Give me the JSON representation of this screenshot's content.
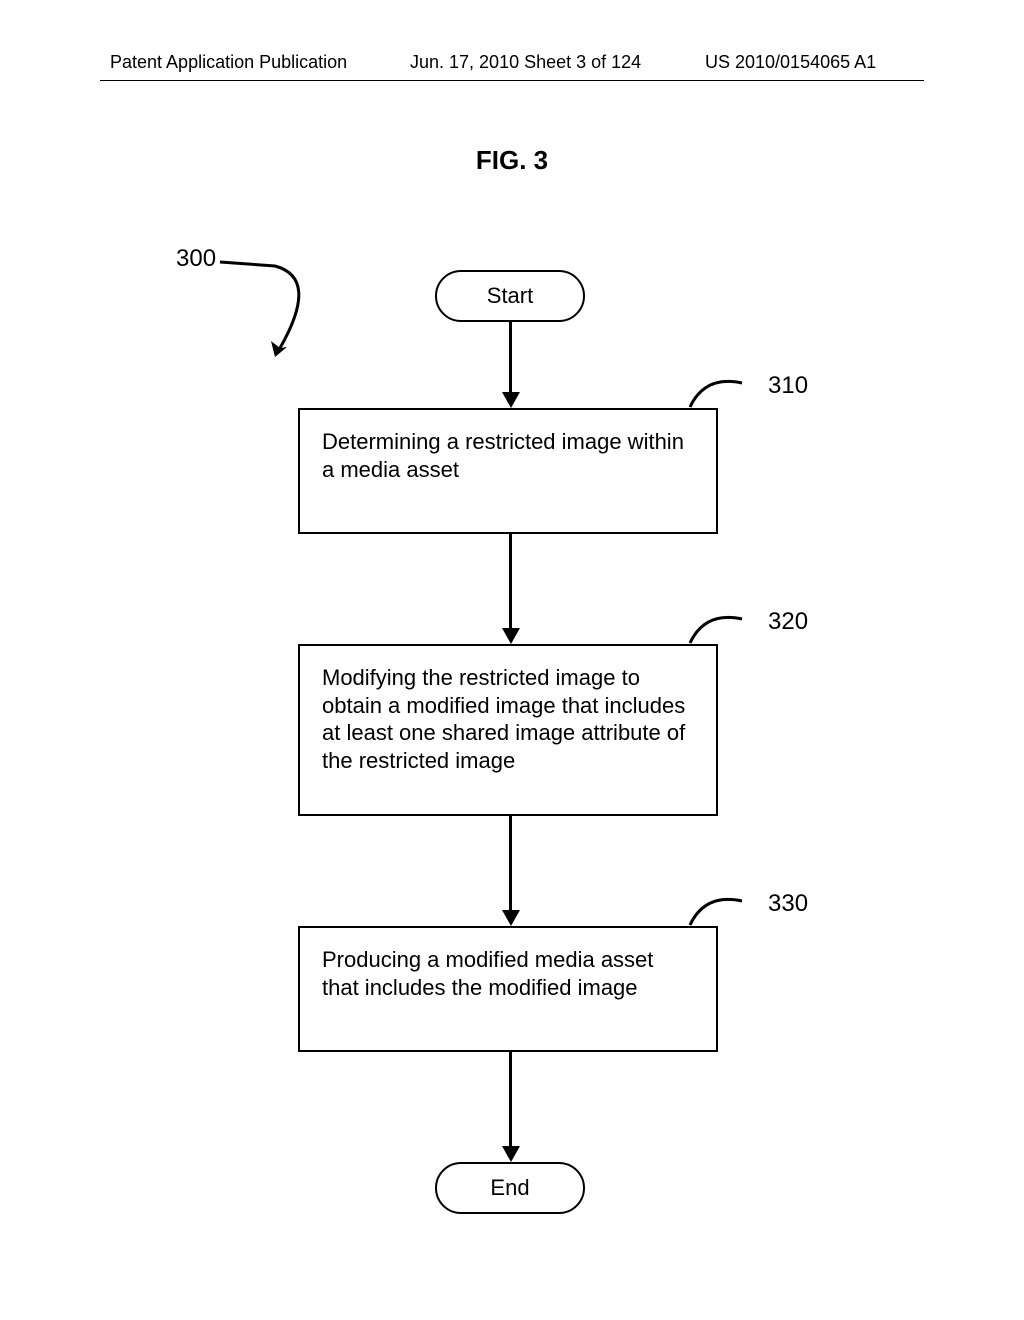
{
  "header": {
    "left": "Patent Application Publication",
    "mid": "Jun. 17, 2010  Sheet 3 of 124",
    "right": "US 2010/0154065 A1"
  },
  "figure": {
    "title": "FIG. 3",
    "ref_main": "300",
    "start": "Start",
    "end": "End",
    "steps": [
      {
        "ref": "310",
        "text": "Determining a restricted image within a media asset"
      },
      {
        "ref": "320",
        "text": "Modifying the restricted image to obtain a modified image that includes at least one shared image attribute of the restricted image"
      },
      {
        "ref": "330",
        "text": "Producing a modified media asset that includes the modified image"
      }
    ]
  },
  "chart_data": {
    "type": "flowchart",
    "title": "FIG. 3",
    "reference": "300",
    "nodes": [
      {
        "id": "start",
        "kind": "terminator",
        "label": "Start"
      },
      {
        "id": "n310",
        "kind": "process",
        "ref": "310",
        "label": "Determining a restricted image within a media asset"
      },
      {
        "id": "n320",
        "kind": "process",
        "ref": "320",
        "label": "Modifying the restricted image to obtain a modified image that includes at least one shared image attribute of the restricted image"
      },
      {
        "id": "n330",
        "kind": "process",
        "ref": "330",
        "label": "Producing a modified media asset that includes the modified image"
      },
      {
        "id": "end",
        "kind": "terminator",
        "label": "End"
      }
    ],
    "edges": [
      {
        "from": "start",
        "to": "n310"
      },
      {
        "from": "n310",
        "to": "n320"
      },
      {
        "from": "n320",
        "to": "n330"
      },
      {
        "from": "n330",
        "to": "end"
      }
    ]
  }
}
